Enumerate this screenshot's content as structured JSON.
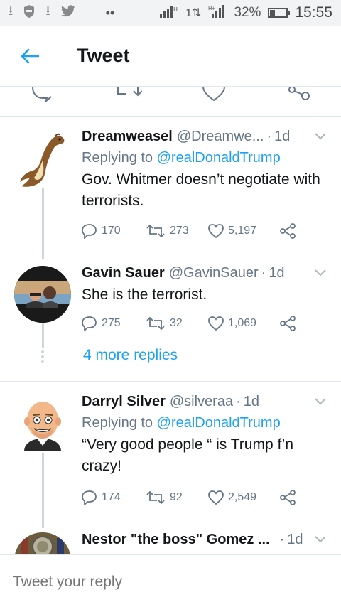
{
  "status_bar": {
    "signal_label": "1l",
    "network": "1",
    "hplus": "H+",
    "battery": "32%",
    "battery_level": 0.32,
    "time": "15:55"
  },
  "header": {
    "title": "Tweet",
    "back_icon": "arrow-left-icon"
  },
  "tweets": [
    {
      "name": "Dreamweasel",
      "handle": "@Dreamwe...",
      "sep": "·",
      "time": "1d",
      "replying_prefix": "Replying to ",
      "replying_to": "@realDonaldTrump",
      "text": "Gov. Whitmer doesn’t negotiate with terrorists.",
      "replies": "170",
      "retweets": "273",
      "likes": "5,197"
    },
    {
      "name": "Gavin Sauer",
      "handle": "@GavinSauer",
      "sep": "·",
      "time": "1d",
      "text": "She is the terrorist.",
      "replies": "275",
      "retweets": "32",
      "likes": "1,069"
    },
    {
      "name": "Darryl Silver",
      "handle": "@silveraa",
      "sep": "·",
      "time": "1d",
      "replying_prefix": "Replying to ",
      "replying_to": "@realDonaldTrump",
      "text": "“Very good people “ is Trump f’n crazy!",
      "replies": "174",
      "retweets": "92",
      "likes": "2,549"
    },
    {
      "name": "Nestor \"the boss\" Gomez ...",
      "sep": "·",
      "time": "1d"
    }
  ],
  "more_replies": "4 more replies",
  "reply_bar": {
    "placeholder": "Tweet your reply"
  },
  "colors": {
    "accent": "#1da1f2",
    "secondary_text": "#657786",
    "divider": "#e1e8ed"
  }
}
